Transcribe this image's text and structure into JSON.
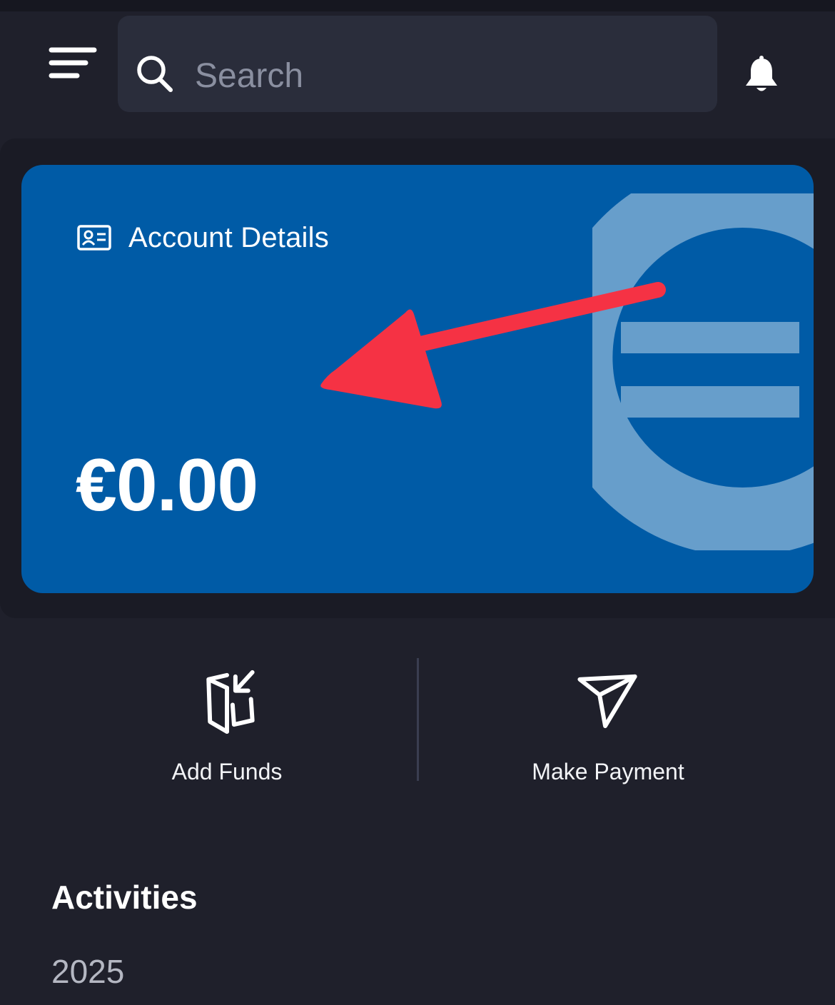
{
  "header": {
    "search": {
      "placeholder": "Search",
      "value": ""
    },
    "icons": {
      "menu": "menu-icon",
      "search": "search-icon",
      "notifications": "bell-icon"
    }
  },
  "account_card": {
    "title": "Account Details",
    "balance": "€0.00",
    "icons": {
      "title": "id-card-icon",
      "watermark": "euro-icon"
    }
  },
  "actions": [
    {
      "label": "Add Funds",
      "icon": "wallet-arrow-in-icon"
    },
    {
      "label": "Make Payment",
      "icon": "send-icon"
    }
  ],
  "activities": {
    "title": "Activities",
    "year": "2025"
  },
  "colors": {
    "background": "#1f202b",
    "card": "#005ba6",
    "watermark": "#679ecb",
    "search_field": "#2a2d3b",
    "annotation_arrow": "#f53244"
  }
}
